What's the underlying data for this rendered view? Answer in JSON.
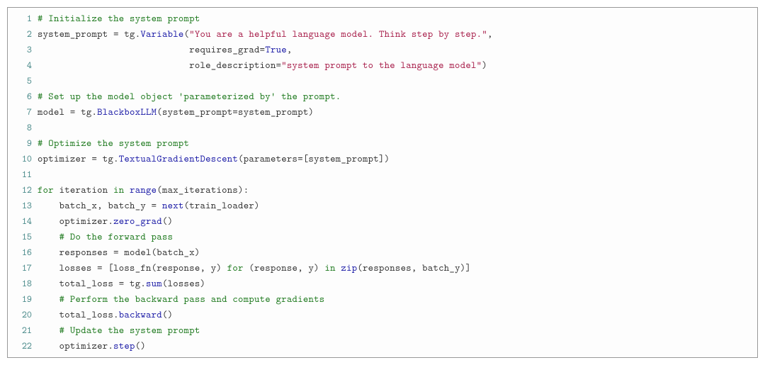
{
  "code": {
    "language": "python",
    "lines": [
      {
        "n": 1,
        "tokens": [
          {
            "t": "# Initialize the system prompt",
            "c": "cm"
          }
        ]
      },
      {
        "n": 2,
        "tokens": [
          {
            "t": "system_prompt = tg.",
            "c": "id"
          },
          {
            "t": "Variable",
            "c": "fn"
          },
          {
            "t": "(",
            "c": "id"
          },
          {
            "t": "\"You are a helpful language model. Think step by step.\"",
            "c": "str"
          },
          {
            "t": ",",
            "c": "id"
          }
        ]
      },
      {
        "n": 3,
        "tokens": [
          {
            "t": "                            requires_grad=",
            "c": "id"
          },
          {
            "t": "True",
            "c": "fn"
          },
          {
            "t": ",",
            "c": "id"
          }
        ]
      },
      {
        "n": 4,
        "tokens": [
          {
            "t": "                            role_description=",
            "c": "id"
          },
          {
            "t": "\"system prompt to the language model\"",
            "c": "str"
          },
          {
            "t": ")",
            "c": "id"
          }
        ]
      },
      {
        "n": 5,
        "tokens": [
          {
            "t": "",
            "c": "id"
          }
        ]
      },
      {
        "n": 6,
        "tokens": [
          {
            "t": "# Set up the model object 'parameterized by' the prompt.",
            "c": "cm"
          }
        ]
      },
      {
        "n": 7,
        "tokens": [
          {
            "t": "model = tg.",
            "c": "id"
          },
          {
            "t": "BlackboxLLM",
            "c": "fn"
          },
          {
            "t": "(system_prompt=system_prompt)",
            "c": "id"
          }
        ]
      },
      {
        "n": 8,
        "tokens": [
          {
            "t": "",
            "c": "id"
          }
        ]
      },
      {
        "n": 9,
        "tokens": [
          {
            "t": "# Optimize the system prompt",
            "c": "cm"
          }
        ]
      },
      {
        "n": 10,
        "tokens": [
          {
            "t": "optimizer = tg.",
            "c": "id"
          },
          {
            "t": "TextualGradientDescent",
            "c": "fn"
          },
          {
            "t": "(parameters=[system_prompt])",
            "c": "id"
          }
        ]
      },
      {
        "n": 11,
        "tokens": [
          {
            "t": "",
            "c": "id"
          }
        ]
      },
      {
        "n": 12,
        "tokens": [
          {
            "t": "for",
            "c": "kw"
          },
          {
            "t": " iteration ",
            "c": "id"
          },
          {
            "t": "in",
            "c": "kw"
          },
          {
            "t": " ",
            "c": "id"
          },
          {
            "t": "range",
            "c": "fn"
          },
          {
            "t": "(max_iterations):",
            "c": "id"
          }
        ]
      },
      {
        "n": 13,
        "tokens": [
          {
            "t": "    batch_x, batch_y = ",
            "c": "id"
          },
          {
            "t": "next",
            "c": "fn"
          },
          {
            "t": "(train_loader)",
            "c": "id"
          }
        ]
      },
      {
        "n": 14,
        "tokens": [
          {
            "t": "    optimizer.",
            "c": "id"
          },
          {
            "t": "zero_grad",
            "c": "fn"
          },
          {
            "t": "()",
            "c": "id"
          }
        ]
      },
      {
        "n": 15,
        "tokens": [
          {
            "t": "    ",
            "c": "id"
          },
          {
            "t": "# Do the forward pass",
            "c": "cm"
          }
        ]
      },
      {
        "n": 16,
        "tokens": [
          {
            "t": "    responses = model(batch_x)",
            "c": "id"
          }
        ]
      },
      {
        "n": 17,
        "tokens": [
          {
            "t": "    losses = [loss_fn(response, y) ",
            "c": "id"
          },
          {
            "t": "for",
            "c": "kw"
          },
          {
            "t": " (response, y) ",
            "c": "id"
          },
          {
            "t": "in",
            "c": "kw"
          },
          {
            "t": " ",
            "c": "id"
          },
          {
            "t": "zip",
            "c": "fn"
          },
          {
            "t": "(responses, batch_y)]",
            "c": "id"
          }
        ]
      },
      {
        "n": 18,
        "tokens": [
          {
            "t": "    total_loss = tg.",
            "c": "id"
          },
          {
            "t": "sum",
            "c": "fn"
          },
          {
            "t": "(losses)",
            "c": "id"
          }
        ]
      },
      {
        "n": 19,
        "tokens": [
          {
            "t": "    ",
            "c": "id"
          },
          {
            "t": "# Perform the backward pass and compute gradients",
            "c": "cm"
          }
        ]
      },
      {
        "n": 20,
        "tokens": [
          {
            "t": "    total_loss.",
            "c": "id"
          },
          {
            "t": "backward",
            "c": "fn"
          },
          {
            "t": "()",
            "c": "id"
          }
        ]
      },
      {
        "n": 21,
        "tokens": [
          {
            "t": "    ",
            "c": "id"
          },
          {
            "t": "# Update the system prompt",
            "c": "cm"
          }
        ]
      },
      {
        "n": 22,
        "tokens": [
          {
            "t": "    optimizer.",
            "c": "id"
          },
          {
            "t": "step",
            "c": "fn"
          },
          {
            "t": "()",
            "c": "id"
          }
        ]
      }
    ]
  }
}
